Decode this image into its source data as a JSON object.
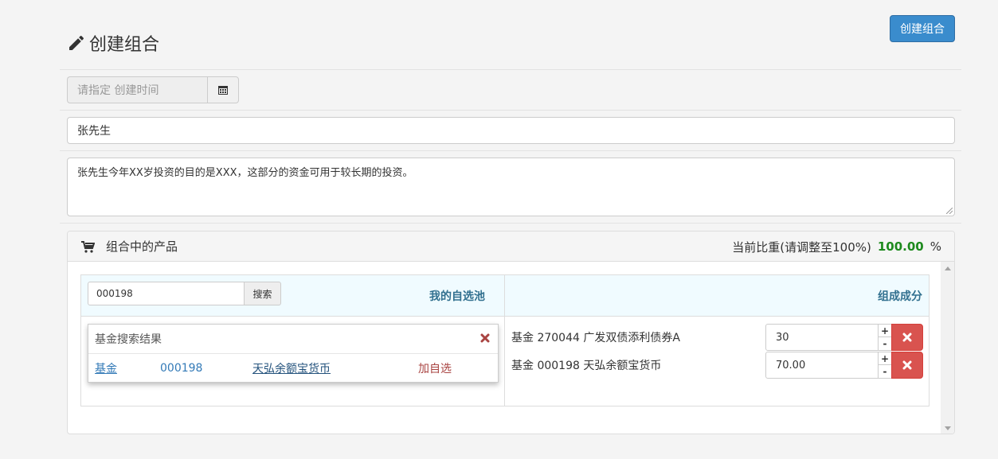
{
  "header": {
    "title": "创建组合",
    "create_button": "创建组合",
    "title_icon": "pencil-icon"
  },
  "form": {
    "date_placeholder": "请指定 创建时间",
    "date_icon": "calendar-icon",
    "name_value": "张先生",
    "description_value": "张先生今年XX岁投资的目的是XXX，这部分的资金可用于较长期的投资。"
  },
  "panel": {
    "title": "组合中的产品",
    "icon": "cart-icon",
    "weight_label": "当前比重(请调整至100%)",
    "weight_value": "100.00",
    "weight_unit": "%"
  },
  "search": {
    "input_value": "000198",
    "button_label": "搜索",
    "watchlist_header": "我的自选池"
  },
  "results": {
    "title": "基金搜索结果",
    "rows": [
      {
        "type": "基金",
        "code": "000198",
        "name": "天弘余额宝货币",
        "action": "加自选"
      }
    ]
  },
  "composition": {
    "header": "组成成分",
    "items": [
      {
        "name": "基金 270044 广发双债添利债券A",
        "weight": "30"
      },
      {
        "name": "基金 000198 天弘余额宝货币",
        "weight": "70.00"
      }
    ],
    "step_up": "+",
    "step_down": "-"
  },
  "colors": {
    "primary": "#3a8ccd",
    "danger": "#d9534f",
    "success_text": "#1e8a1e",
    "table_header_bg": "#f0fbff",
    "header_text": "#31708f"
  }
}
